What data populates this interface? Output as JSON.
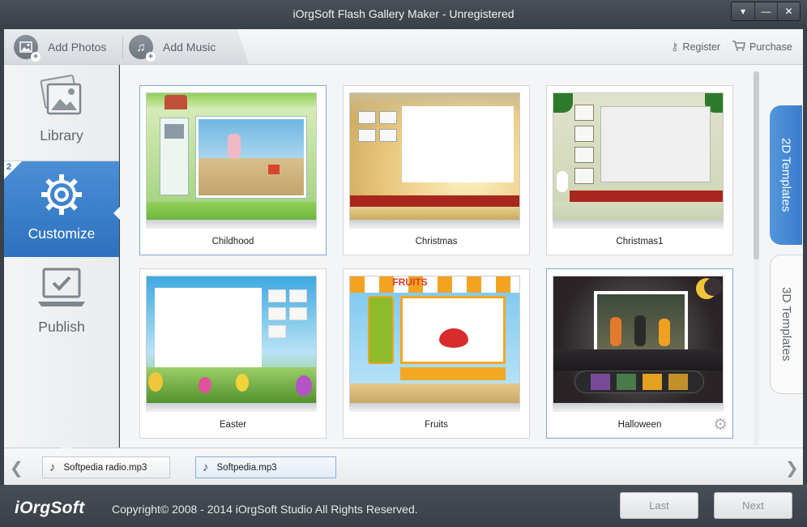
{
  "window": {
    "title": "iOrgSoft Flash Gallery Maker - Unregistered",
    "controls": [
      "▾",
      "—",
      "✕"
    ]
  },
  "toolbar": {
    "add_photos": "Add Photos",
    "add_music": "Add Music",
    "register": "Register",
    "purchase": "Purchase"
  },
  "sidebar": {
    "items": [
      {
        "label": "Library",
        "icon": "library-icon"
      },
      {
        "label": "Customize",
        "icon": "gear-icon",
        "step": "2",
        "active": true
      },
      {
        "label": "Publish",
        "icon": "laptop-check-icon"
      }
    ]
  },
  "templates": [
    {
      "name": "Childhood"
    },
    {
      "name": "Christmas"
    },
    {
      "name": "Christmas1"
    },
    {
      "name": "Easter"
    },
    {
      "name": "Fruits"
    },
    {
      "name": "Halloween"
    }
  ],
  "fruits_banner": "FRUITS",
  "tabs": {
    "tab_2d": "2D Templates",
    "tab_3d": "3D Templates"
  },
  "music": {
    "tracks": [
      "Softpedia radio.mp3",
      "Softpedia.mp3"
    ]
  },
  "footer": {
    "logo": "iOrgSoft",
    "copyright": "Copyright© 2008 - 2014 iOrgSoft Studio All Rights Reserved.",
    "last": "Last",
    "next": "Next"
  },
  "colors": {
    "accent": "#3a7ccb",
    "titlebar": "#3f454c"
  }
}
